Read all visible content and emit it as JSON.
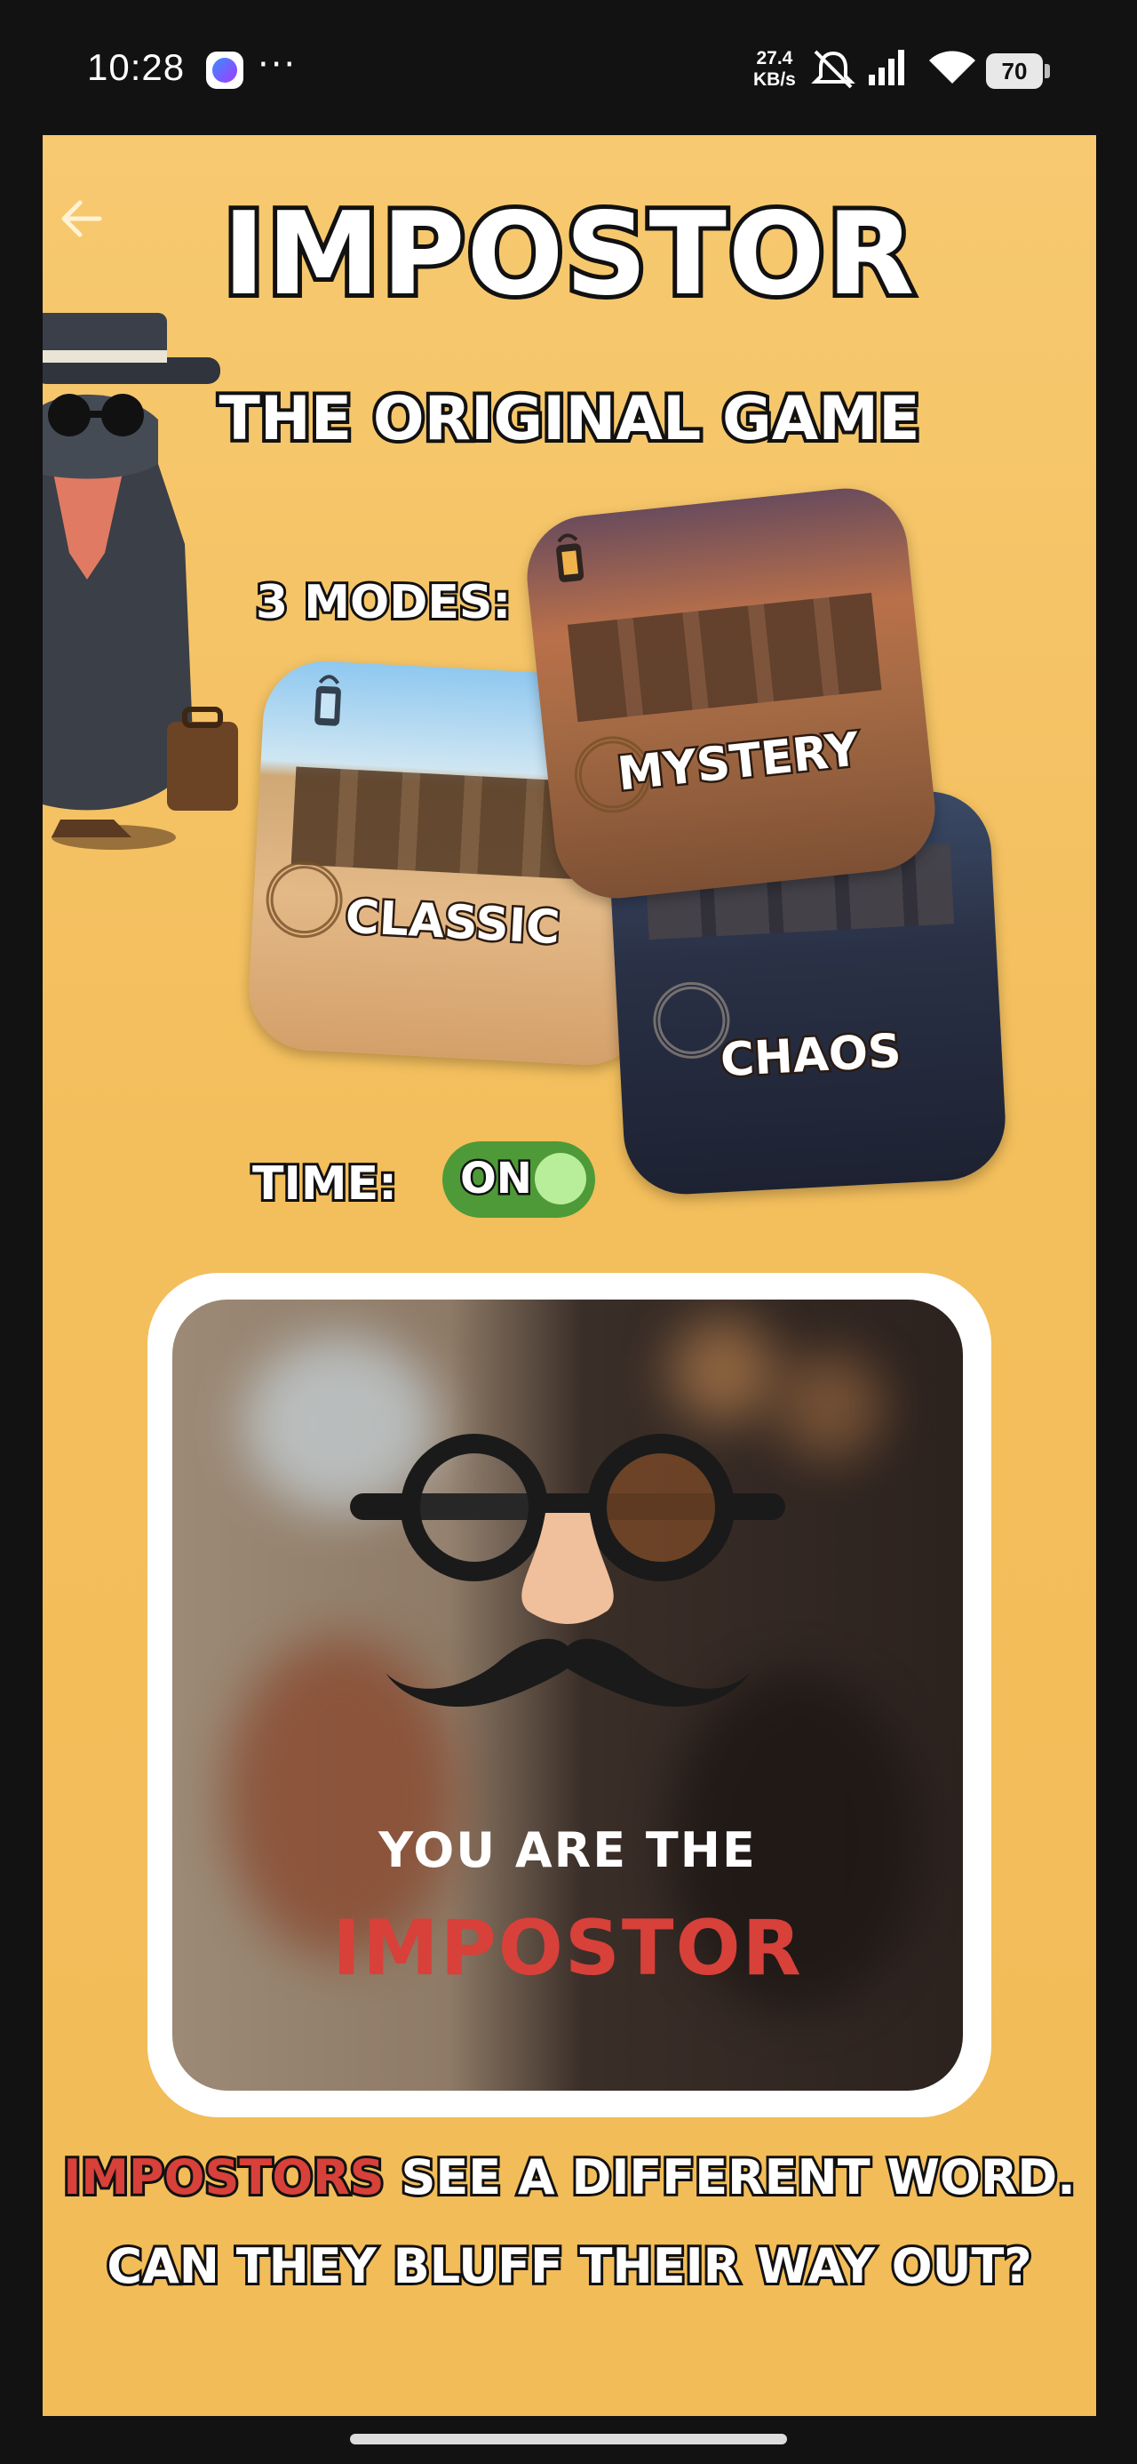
{
  "status_bar": {
    "time": "10:28",
    "more": "···",
    "net_speed_value": "27.4",
    "net_speed_unit": "KB/s",
    "battery": "70",
    "icons": [
      "messenger-icon",
      "mute-icon",
      "signal-icon",
      "wifi-icon",
      "battery-icon"
    ]
  },
  "header": {
    "back_icon": "arrow-left-icon",
    "title": "IMPOSTOR",
    "subtitle": "THE ORIGINAL GAME"
  },
  "modes": {
    "label": "3 MODES:",
    "items": [
      {
        "label": "CLASSIC"
      },
      {
        "label": "MYSTERY"
      },
      {
        "label": "CHAOS"
      }
    ]
  },
  "timer": {
    "label": "TIME:",
    "toggle_text": "ON",
    "enabled": true
  },
  "preview": {
    "line1": "YOU ARE THE",
    "line2": "IMPOSTOR"
  },
  "description": {
    "line1_highlight": "IMPOSTORS",
    "line1_rest": " SEE A DIFFERENT WORD.",
    "line2": "CAN THEY BLUFF THEIR WAY OUT?"
  },
  "colors": {
    "background": "#f3be5c",
    "accent_red": "#d8403a",
    "toggle_green": "#4e9a38"
  }
}
